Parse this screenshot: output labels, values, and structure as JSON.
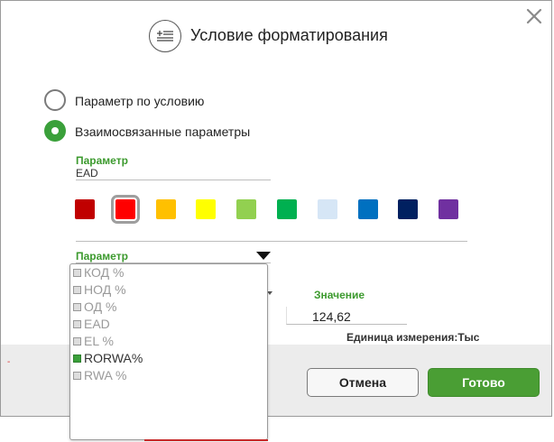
{
  "dialog": {
    "title": "Условие форматирования",
    "icons": {
      "close": "close-icon",
      "title": "format-condition-icon"
    }
  },
  "radios": [
    {
      "label": "Параметр по условию",
      "selected": false
    },
    {
      "label": "Взаимосвязанные параметры",
      "selected": true
    }
  ],
  "parameter_field": {
    "label": "Параметр",
    "value": "EAD"
  },
  "colors": {
    "swatches": [
      "#c00000",
      "#ff0000",
      "#ffc000",
      "#ffff00",
      "#92d050",
      "#00b050",
      "#d6e6f6",
      "#0070c0",
      "#002060",
      "#7030a0"
    ],
    "selected_index": 1
  },
  "parameter_dropdown": {
    "label": "Параметр",
    "items": [
      "КОД %",
      "НОД %",
      "ОД %",
      "EAD",
      "EL %",
      "RORWA%",
      "RWA %"
    ],
    "active_index": 5
  },
  "value_field": {
    "label": "Значение",
    "value": "124,62"
  },
  "unit_text": "Единица измерения:Тыс",
  "buttons": {
    "cancel": "Отмена",
    "ok": "Готово"
  },
  "footer_mark": "-"
}
